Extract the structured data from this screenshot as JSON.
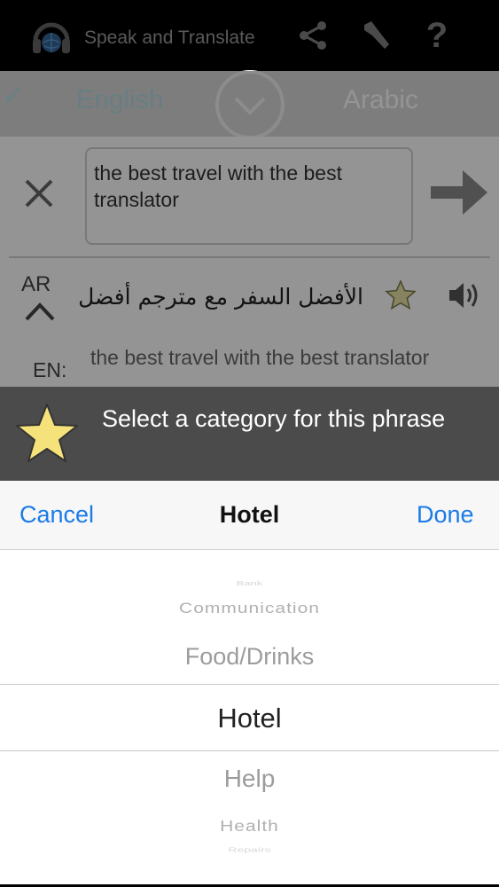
{
  "app": {
    "title": "Speak and Translate",
    "help_glyph": "?"
  },
  "languages": {
    "check_glyph": "✓",
    "from": "English",
    "to": "Arabic"
  },
  "input": {
    "text": "the best travel with the best translator"
  },
  "result": {
    "ar_label": "AR",
    "ar_text": "الأفضل السفر مع مترجم أفضل",
    "en_label": "EN:",
    "en_text": "the best travel with the best translator"
  },
  "banner": {
    "text": "Select a category for this phrase",
    "star_color": "#f6e27a"
  },
  "picker": {
    "cancel_label": "Cancel",
    "title": "Hotel",
    "done_label": "Done",
    "items": [
      "Bank",
      "Communication",
      "Food/Drinks",
      "Hotel",
      "Help",
      "Health",
      "Repairs"
    ],
    "selected": "Hotel"
  },
  "colors": {
    "accent": "#1a7be8",
    "banner_bg": "#4b4b4b"
  }
}
